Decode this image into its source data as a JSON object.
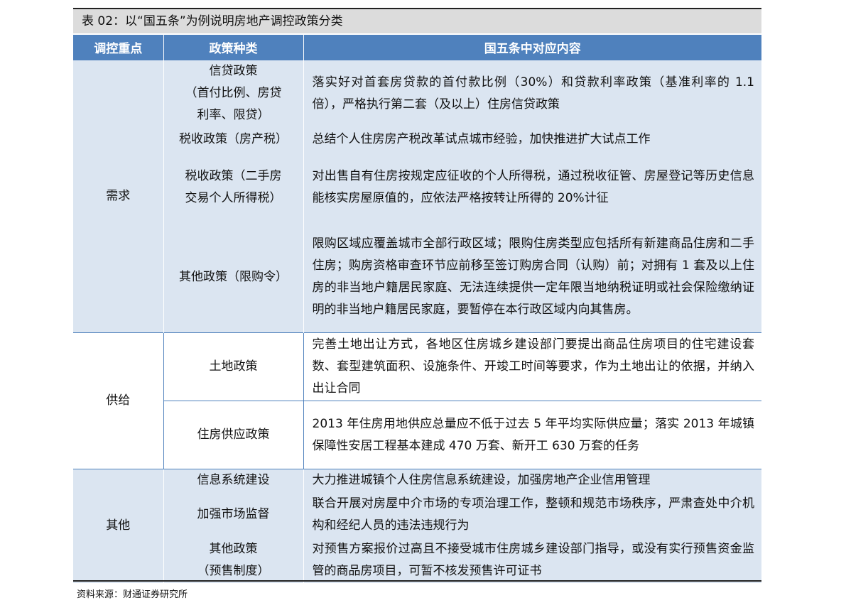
{
  "title": "表 02：以“国五条”为例说明房地产调控政策分类",
  "headers": [
    "调控重点",
    "政策种类",
    "国五条中对应内容"
  ],
  "groups": [
    {
      "category": "需求",
      "rows": [
        {
          "type": "信贷政策\n（首付比例、房贷\n利率、限贷）",
          "content": "落实好对首套房贷款的首付款比例（30%）和贷款利率政策（基准利率的 1.1 倍），严格执行第二套（及以上）住房信贷政策"
        },
        {
          "type": "税收政策（房产税）",
          "content": "总结个人住房房产税改革试点城市经验，加快推进扩大试点工作"
        },
        {
          "type": "税收政策（二手房\n交易个人所得税）",
          "content": "对出售自有住房按规定应征收的个人所得税，通过税收征管、房屋登记等历史信息能核实房屋原值的，应依法严格按转让所得的 20%计征"
        },
        {
          "type": "其他政策（限购令）",
          "content": "限购区域应覆盖城市全部行政区域；限购住房类型应包括所有新建商品住房和二手住房；购房资格审查环节应前移至签订购房合同（认购）前；对拥有 1 套及以上住房的非当地户籍居民家庭、无法连续提供一定年限当地纳税证明或社会保险缴纳证明的非当地户籍居民家庭，要暂停在本行政区域内向其售房。"
        }
      ]
    },
    {
      "category": "供给",
      "rows": [
        {
          "type": "土地政策",
          "content": "完善土地出让方式，各地区住房城乡建设部门要提出商品住房项目的住宅建设套数、套型建筑面积、设施条件、开竣工时间等要求，作为土地出让的依据，并纳入出让合同"
        },
        {
          "type": "住房供应政策",
          "content": "2013 年住房用地供应总量应不低于过去 5 年平均实际供应量；落实 2013 年城镇保障性安居工程基本建成 470 万套、新开工 630 万套的任务"
        }
      ]
    },
    {
      "category": "其他",
      "rows": [
        {
          "type": "信息系统建设",
          "content": "大力推进城镇个人住房信息系统建设，加强房地产企业信用管理"
        },
        {
          "type": "加强市场监督",
          "content": "联合开展对房屋中介市场的专项治理工作，整顿和规范市场秩序，严肃查处中介机构和经纪人员的违法违规行为"
        },
        {
          "type": "其他政策\n（预售制度）",
          "content": "对预售方案报价过高且不接受城市住房城乡建设部门指导，或没有实行预售资金监管的商品房项目，可暂不核发预售许可证书"
        }
      ]
    }
  ],
  "source": "资料来源：财通证券研究所"
}
